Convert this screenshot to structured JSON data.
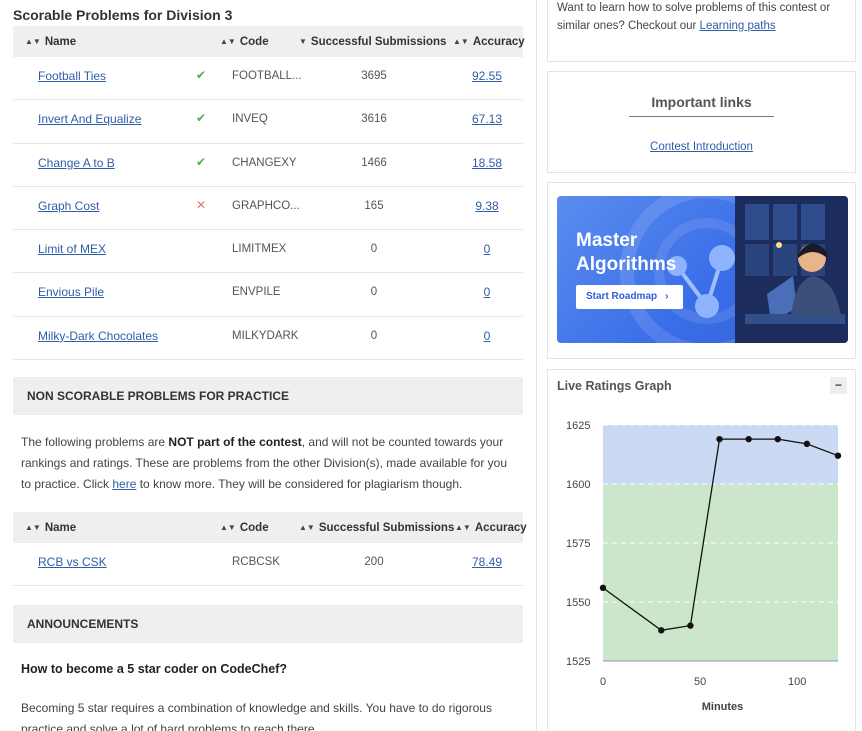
{
  "scorable": {
    "title": "Scorable Problems for Division 3",
    "headers": {
      "name": "Name",
      "code": "Code",
      "submissions": "Successful Submissions",
      "accuracy": "Accuracy"
    },
    "rows": [
      {
        "name": "Football Ties",
        "status": "solved",
        "code": "FOOTBALL...",
        "submissions": "3695",
        "accuracy": "92.55"
      },
      {
        "name": "Invert And Equalize",
        "status": "solved",
        "code": "INVEQ",
        "submissions": "3616",
        "accuracy": "67.13"
      },
      {
        "name": "Change A to B",
        "status": "solved",
        "code": "CHANGEXY",
        "submissions": "1466",
        "accuracy": "18.58"
      },
      {
        "name": "Graph Cost",
        "status": "failed",
        "code": "GRAPHCO...",
        "submissions": "165",
        "accuracy": "9.38"
      },
      {
        "name": "Limit of MEX",
        "status": "none",
        "code": "LIMITMEX",
        "submissions": "0",
        "accuracy": "0"
      },
      {
        "name": "Envious Pile",
        "status": "none",
        "code": "ENVPILE",
        "submissions": "0",
        "accuracy": "0"
      },
      {
        "name": "Milky-Dark Chocolates",
        "status": "none",
        "code": "MILKYDARK",
        "submissions": "0",
        "accuracy": "0"
      }
    ]
  },
  "non_scorable": {
    "title": "NON SCORABLE PROBLEMS FOR PRACTICE",
    "para_1": "The following problems are ",
    "para_bold": "NOT part of the contest",
    "para_2": ", and will not be counted towards your rankings and ratings. These are problems from the other Division(s), made available for you to practice. Click ",
    "para_link": "here",
    "para_3": " to know more. They will be considered for plagiarism though.",
    "headers": {
      "name": "Name",
      "code": "Code",
      "submissions": "Successful Submissions",
      "accuracy": "Accuracy"
    },
    "rows": [
      {
        "name": "RCB vs CSK",
        "code": "RCBCSK",
        "submissions": "200",
        "accuracy": "78.49"
      }
    ]
  },
  "announcements": {
    "title": "ANNOUNCEMENTS",
    "heading": "How to become a 5 star coder on CodeChef?",
    "body": "Becoming 5 star requires a combination of knowledge and skills. You have to do rigorous practice and solve a lot of hard problems to reach there."
  },
  "learn_card": {
    "text": "Want to learn how to solve problems of this contest or similar ones? Checkout our ",
    "link": "Learning paths"
  },
  "links_card": {
    "title": "Important links",
    "link": "Contest Introduction"
  },
  "banner": {
    "line1": "Master",
    "line2": "Algorithms",
    "button": "Start Roadmap"
  },
  "ratings": {
    "title": "Live Ratings Graph",
    "collapse": "−"
  },
  "chart_data": {
    "type": "line",
    "title": "Live Ratings Graph",
    "xlabel": "Minutes",
    "ylabel": "",
    "xlim": [
      0,
      121
    ],
    "ylim": [
      1525,
      1625
    ],
    "xticks": [
      "0",
      "50",
      "100"
    ],
    "yticks": [
      "1625",
      "1600",
      "1575",
      "1550",
      "1525"
    ],
    "bands": [
      {
        "from": 1525,
        "to": 1600,
        "color": "#cce6cc"
      },
      {
        "from": 1600,
        "to": 1625,
        "color": "#ccd9f2"
      }
    ],
    "x": [
      0,
      30,
      45,
      60,
      75,
      90,
      105,
      121
    ],
    "y": [
      1556,
      1538,
      1540,
      1619,
      1619,
      1619,
      1617,
      1612
    ]
  },
  "colors": {
    "link": "#2f5ea8",
    "solved": "#4caf50",
    "failed": "#e57373",
    "header_bg": "#efefef"
  }
}
